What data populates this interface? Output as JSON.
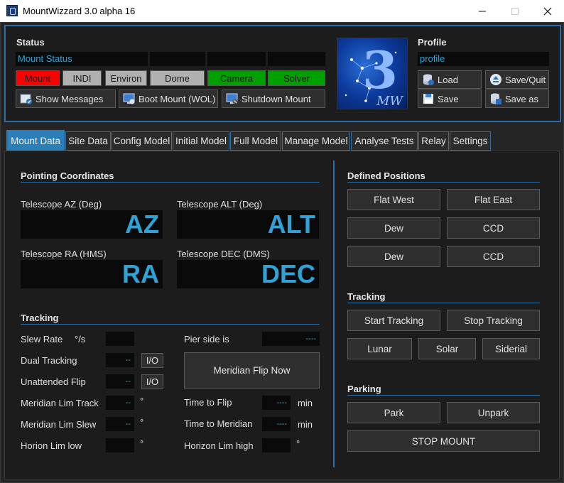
{
  "window": {
    "title": "MountWizzard 3.0 alpha 16"
  },
  "status": {
    "title": "Status",
    "mount_status_text": "Mount Status",
    "indicators": [
      "Mount",
      "INDI",
      "Environ",
      "Dome",
      "Camera",
      "Solver"
    ],
    "buttons": [
      "Show Messages",
      "Boot Mount (WOL)",
      "Shutdown Mount"
    ]
  },
  "logo": {
    "big": "3",
    "small": "MW"
  },
  "profile": {
    "title": "Profile",
    "value": "profile",
    "buttons": [
      "Load",
      "Save/Quit",
      "Save",
      "Save as"
    ]
  },
  "tabs": [
    "Mount Data",
    "Site Data",
    "Config Model",
    "Initial Model",
    "Full Model",
    "Manage Model",
    "Analyse Tests",
    "Relay",
    "Settings"
  ],
  "pointing": {
    "title": "Pointing Coordinates",
    "az_label": "Telescope AZ (Deg)",
    "az_value": "AZ",
    "alt_label": "Telescope ALT (Deg)",
    "alt_value": "ALT",
    "ra_label": "Telescope RA (HMS)",
    "ra_value": "RA",
    "dec_label": "Telescope DEC (DMS)",
    "dec_value": "DEC"
  },
  "tracking_left": {
    "title": "Tracking",
    "slew_rate_label": "Slew Rate",
    "slew_rate_unit": "°/s",
    "dual_tracking_label": "Dual Tracking",
    "dual_tracking_value": "--",
    "unattended_flip_label": "Unattended Flip",
    "unattended_flip_value": "--",
    "io_label": "I/O",
    "mer_lim_track_label": "Meridian Lim Track",
    "mer_lim_track_value": "--",
    "mer_lim_slew_label": "Meridian Lim Slew",
    "mer_lim_slew_value": "--",
    "horizon_low_label": "Horion Lim low",
    "deg_unit": "°",
    "pier_side_label": "Pier side is",
    "pier_side_value": "----",
    "meridian_flip_now": "Meridian Flip Now",
    "time_to_flip_label": "Time to Flip",
    "time_to_flip_value": "----",
    "time_to_meridian_label": "Time to Meridian",
    "time_to_meridian_value": "----",
    "min_unit": "min",
    "horizon_high_label": "Horizon Lim high"
  },
  "defined_positions": {
    "title": "Defined Positions",
    "buttons": [
      "Flat West",
      "Flat East",
      "Dew",
      "CCD",
      "Dew",
      "CCD"
    ]
  },
  "tracking_right": {
    "title": "Tracking",
    "start": "Start Tracking",
    "stop": "Stop Tracking",
    "lunar": "Lunar",
    "solar": "Solar",
    "sidereal": "Siderial"
  },
  "parking": {
    "title": "Parking",
    "park": "Park",
    "unpark": "Unpark",
    "stop_mount": "STOP MOUNT"
  },
  "colors": {
    "accent": "#2a7fb8",
    "frame_border": "#2a6ea5",
    "value_text": "#2fa3d8",
    "indicator_red": "#ff0000",
    "indicator_green": "#00a000",
    "indicator_grey": "#b0b0b0"
  },
  "icons": {
    "message": "message-icon",
    "boot": "monitor-icon",
    "shutdown": "monitor-off-icon",
    "load": "database-icon",
    "save_quit": "eject-icon",
    "save": "floppy-icon",
    "save_as": "database-save-icon"
  }
}
